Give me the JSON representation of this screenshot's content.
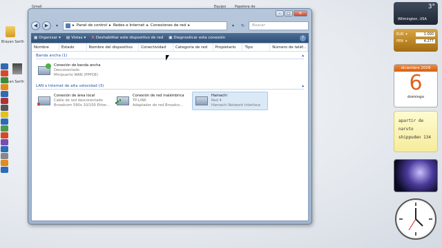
{
  "desktop": {
    "top_labels": [
      "Gmail",
      "Equipo",
      "Papelera de"
    ],
    "icon_labels": [
      "Brayan Sarth",
      "Brayan Sarth"
    ]
  },
  "window": {
    "address": {
      "segments": [
        "Panel de control",
        "Redes e Internet",
        "Conexiones de red"
      ],
      "search_placeholder": "Buscar"
    },
    "toolbar": {
      "organize": "Organizar",
      "views": "Vistas",
      "disable": "Deshabilitar este dispositivo de red",
      "diagnose": "Diagnosticar esta conexión"
    },
    "columns": [
      "Nombre",
      "Estado",
      "Nombre del dispositivo",
      "Conectividad",
      "Categoría de red",
      "Propietario",
      "Tipo",
      "Número de teléf..."
    ],
    "groups": [
      {
        "title": "Banda ancha (1)",
        "items": [
          {
            "name": "Conexión de banda ancha",
            "line2": "Desconectado",
            "line3": "Minipuerto WAN (PPPOE)"
          }
        ]
      },
      {
        "title": "LAN o Internet de alta velocidad (3)",
        "items": [
          {
            "name": "Conexión de área local",
            "line2": "Cable de red desconectado",
            "line3": "Broadcom 590x 10/100 Ether..."
          },
          {
            "name": "Conexión de red inalámbrica",
            "line2": "TP-LINK",
            "line3": "Adaptador de red Broadco..."
          },
          {
            "name": "Hamachi",
            "line2": "Red 4",
            "line3": "Hamachi Network Interface"
          }
        ]
      }
    ]
  },
  "gadgets": {
    "weather": {
      "temp": "3°",
      "city": "Wilmington, USA"
    },
    "currency": [
      {
        "code": "EUR",
        "value": "1.000"
      },
      {
        "code": "PEN",
        "value": "4.277"
      }
    ],
    "calendar": {
      "month": "diciembre 2009",
      "day": "6",
      "weekday": "domingo"
    },
    "note": "apartir de naruto shippuden 134"
  }
}
